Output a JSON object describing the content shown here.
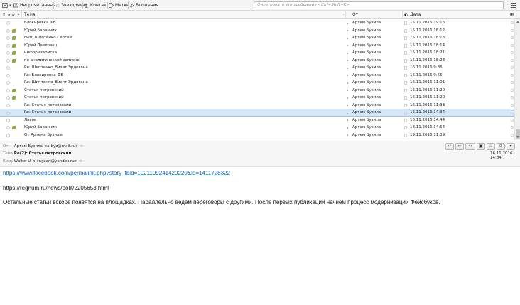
{
  "toolbar": {
    "unread": "Непрочитанные",
    "starred": "Звездочка",
    "contact": "Контакт",
    "tags": "Метки",
    "attachments": "Вложения",
    "filter_placeholder": "Фильтровать эти сообщения <Ctrl+Shift+K>"
  },
  "columns": {
    "subject": "Тема",
    "from": "От",
    "date": "Дата"
  },
  "messages": [
    {
      "subject": "Блокировка ФБ",
      "from": "Артем Бузила",
      "date": "15.11.2016 19:16",
      "tag": false
    },
    {
      "subject": "Юрий Баранчик",
      "from": "Артем Бузила",
      "date": "15.11.2016 18:12",
      "tag": true
    },
    {
      "subject": "Fwd: Шиптенко Сергей",
      "from": "Артем Бузила",
      "date": "15.11.2016 18:13",
      "tag": true
    },
    {
      "subject": "Юрий Павловец",
      "from": "Артем Бузила",
      "date": "15.11.2016 18:14",
      "tag": true
    },
    {
      "subject": "информзаписка",
      "from": "Артем Бузила",
      "date": "15.11.2016 18:21",
      "tag": true
    },
    {
      "subject": "по аналитической записке",
      "from": "Артем Бузила",
      "date": "15.11.2016 18:23",
      "tag": true
    },
    {
      "subject": "Re: Шиптенко_Визит Эрдогана",
      "from": "Артем Бузила",
      "date": "16.11.2016 9:36",
      "tag": false
    },
    {
      "subject": "Re: Блокировка ФБ",
      "from": "Артем Бузила",
      "date": "16.11.2016 9:55",
      "tag": false
    },
    {
      "subject": "Re: Шиптенко_Визит Эрдогана",
      "from": "Артем Бузила",
      "date": "16.11.2016 11:01",
      "tag": false
    },
    {
      "subject": "Статья петровский",
      "from": "Артем Бузила",
      "date": "16.11.2016 11:20",
      "tag": true
    },
    {
      "subject": "Статья петровский",
      "from": "Артем Бузила",
      "date": "16.11.2016 11:20",
      "tag": true
    },
    {
      "subject": "Re: Статья петровский",
      "from": "Артем Бузила",
      "date": "16.11.2016 11:33",
      "tag": false
    },
    {
      "subject": "Re: Статья петровский",
      "from": "Артем Бузила",
      "date": "16.11.2016 14:34",
      "tag": false,
      "selected": true
    },
    {
      "subject": "Львов",
      "from": "Артем Бузила",
      "date": "16.11.2016 14:44",
      "tag": false
    },
    {
      "subject": "Юрий Баранчик",
      "from": "Артем Бузила",
      "date": "18.11.2016 14:54",
      "tag": true
    },
    {
      "subject": "От Артема Бузилы",
      "from": "Артем Бузила",
      "date": "19.11.2016 11:39",
      "tag": false
    }
  ],
  "header": {
    "from_label": "От",
    "from_value": "Артем Бузила <a-byz@mail.ru>",
    "subject_label": "Тема",
    "subject_value": "Re(2): Статья петровский",
    "to_label": "Кому",
    "to_value": "Walter U <iengzari@yandex.ru>",
    "date": "16.11.2016 14:34"
  },
  "body": {
    "link": "https://www.facebook.com/permalink.php?story_fbid=1021109241429220&id=1411728322",
    "line2": "https://regnum.ru/news/polit/2205653.html",
    "line3": "Остальные статьи вскоре появятся на площадках. Параллельно ведём переговоры с другими. После первых публикаций начнём процесс модернизации Фейсбуков."
  },
  "colors": {
    "selected_row": "#d6e6f8",
    "tag_green": "#8ea84a",
    "link": "#1a5fb4"
  }
}
